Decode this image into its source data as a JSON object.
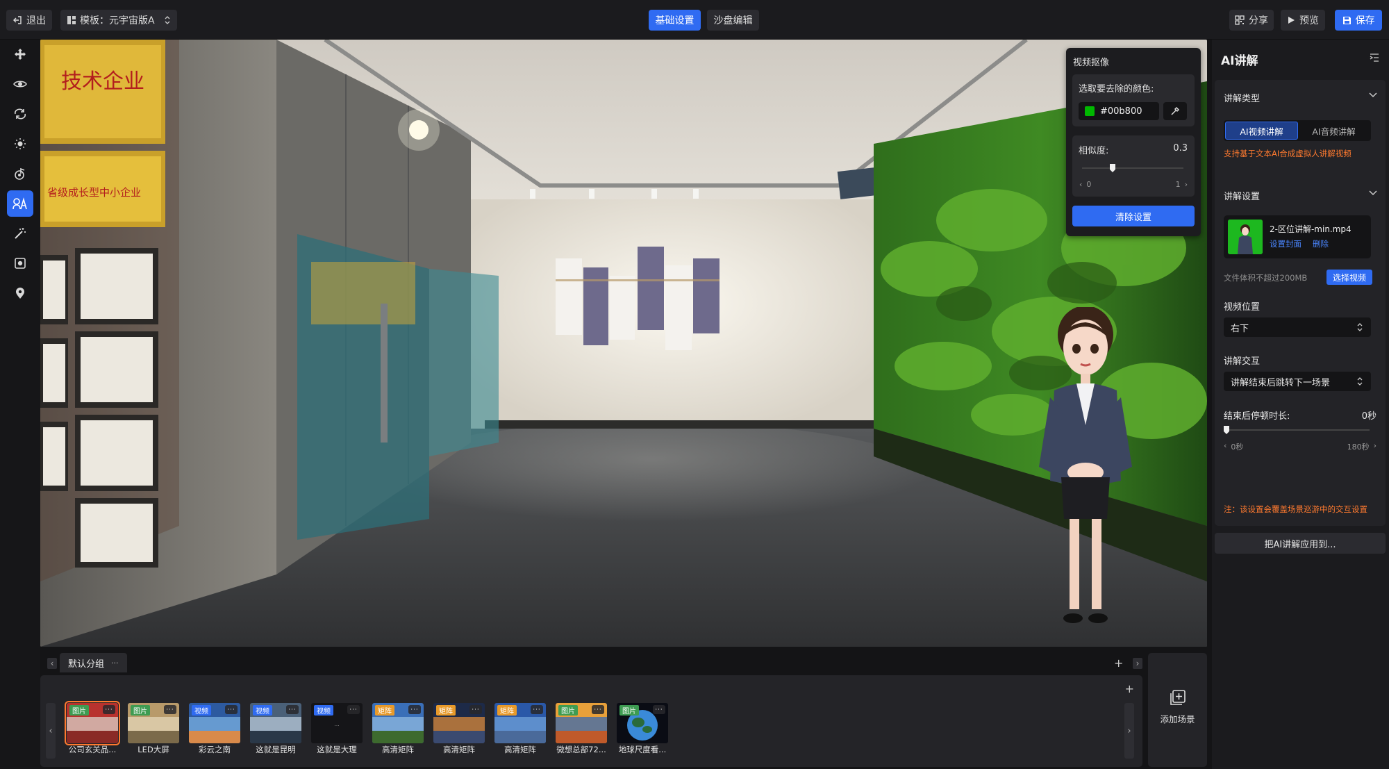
{
  "topbar": {
    "exit_label": "退出",
    "template_label": "模板：元宇宙版A",
    "tabs": [
      {
        "label": "基础设置"
      },
      {
        "label": "沙盘编辑"
      }
    ],
    "share_label": "分享",
    "preview_label": "预览",
    "save_label": "保存"
  },
  "left_tools": [
    "move-icon",
    "eye-icon",
    "rotate-icon",
    "sun-icon",
    "music-note-icon",
    "ai-avatar-icon",
    "magic-wand-icon",
    "frame-icon",
    "location-pin-icon"
  ],
  "video_matting": {
    "title": "视频抠像",
    "color_label": "选取要去除的颜色:",
    "color_value": "#00b800",
    "similarity_label": "相似度:",
    "similarity_value": "0.3",
    "similarity_min": "0",
    "similarity_max": "1",
    "similarity": 0.3,
    "clear_label": "清除设置"
  },
  "ai_panel": {
    "title": "AI讲解",
    "type_section": "讲解类型",
    "type_options": [
      "AI视频讲解",
      "AI音频讲解"
    ],
    "type_hint": "支持基于文本AI合成虚拟人讲解视频",
    "settings_section": "讲解设置",
    "video_name": "2-区位讲解-min.mp4",
    "set_cover": "设置封面",
    "delete": "删除",
    "size_limit": "文件体积不超过200MB",
    "choose_video": "选择视频",
    "position_label": "视频位置",
    "position_value": "右下",
    "interaction_label": "讲解交互",
    "interaction_value": "讲解结束后跳转下一场景",
    "pause_label": "结束后停顿时长:",
    "pause_value": "0秒",
    "pause_min": "0秒",
    "pause_max": "180秒",
    "pause_fraction": 0,
    "note": "注：该设置会覆盖场景巡游中的交互设置",
    "apply_label": "把AI讲解应用到..."
  },
  "bottom": {
    "group_name": "默认分组",
    "add_scene_label": "添加场景",
    "scenes": [
      {
        "badge": "图片",
        "label": "公司玄关品..."
      },
      {
        "badge": "图片",
        "label": "LED大屏"
      },
      {
        "badge": "视频",
        "label": "彩云之南"
      },
      {
        "badge": "视频",
        "label": "这就是昆明"
      },
      {
        "badge": "视频",
        "label": "这就是大理"
      },
      {
        "badge": "矩阵",
        "label": "高清矩阵"
      },
      {
        "badge": "矩阵",
        "label": "高清矩阵"
      },
      {
        "badge": "矩阵",
        "label": "高清矩阵"
      },
      {
        "badge": "图片",
        "label": "微想总部72..."
      },
      {
        "badge": "图片",
        "label": "地球尺度看..."
      }
    ]
  },
  "scene_signs": {
    "sign1": "技术企业",
    "sign2": "省级成长型中小企业"
  },
  "colors": {
    "accent": "#2f6bf2",
    "warning": "#ff7a2f",
    "key_green": "#00b800"
  }
}
